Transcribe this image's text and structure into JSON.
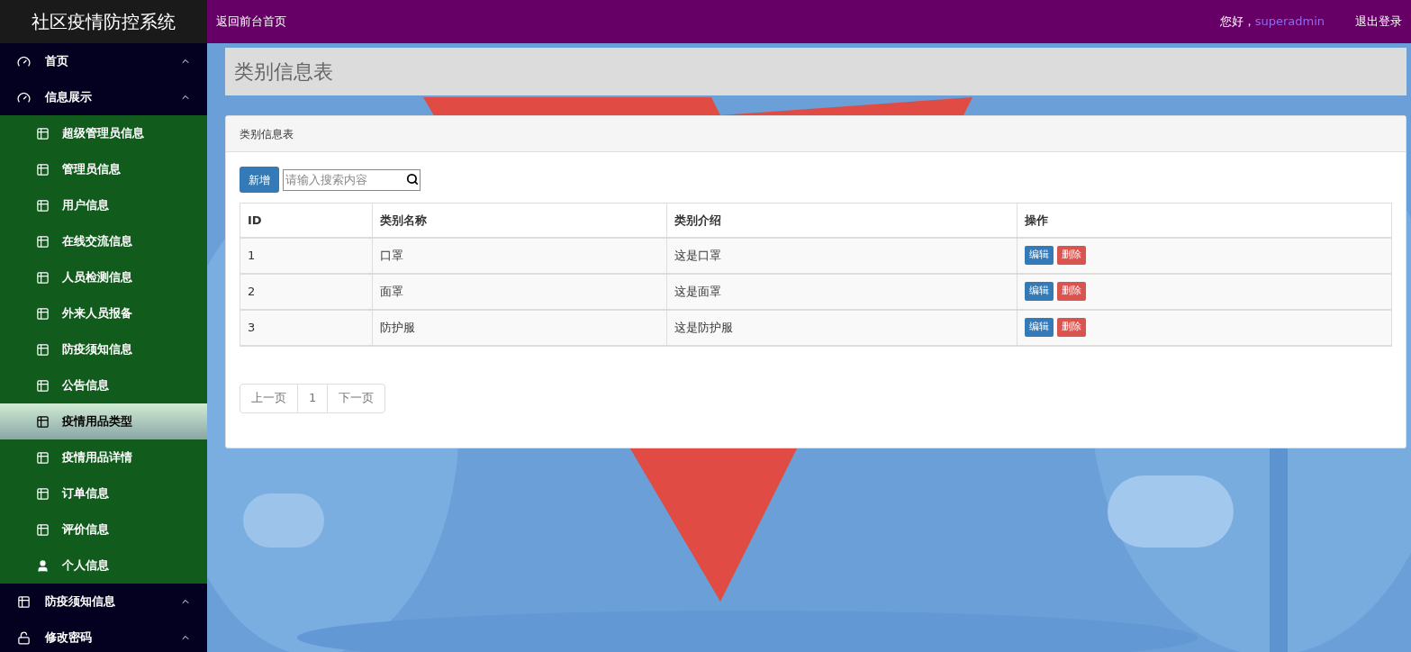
{
  "brand": "社区疫情防控系统",
  "topbar": {
    "home_link": "返回前台首页",
    "greeting": "您好，",
    "user": "superadmin",
    "logout": "退出登录"
  },
  "sidebar": {
    "groups": [
      {
        "label": "首页",
        "kind": "dashboard",
        "expanded": true
      },
      {
        "label": "信息展示",
        "kind": "dashboard",
        "expanded": true,
        "children": [
          {
            "label": "超级管理员信息",
            "kind": "table",
            "selected": false
          },
          {
            "label": "管理员信息",
            "kind": "table",
            "selected": false
          },
          {
            "label": "用户信息",
            "kind": "table",
            "selected": false
          },
          {
            "label": "在线交流信息",
            "kind": "table",
            "selected": false
          },
          {
            "label": "人员检测信息",
            "kind": "table",
            "selected": false
          },
          {
            "label": "外来人员报备",
            "kind": "table",
            "selected": false
          },
          {
            "label": "防疫须知信息",
            "kind": "table",
            "selected": false
          },
          {
            "label": "公告信息",
            "kind": "table",
            "selected": false
          },
          {
            "label": "疫情用品类型",
            "kind": "table",
            "selected": true
          },
          {
            "label": "疫情用品详情",
            "kind": "table",
            "selected": false
          },
          {
            "label": "订单信息",
            "kind": "table",
            "selected": false
          },
          {
            "label": "评价信息",
            "kind": "table",
            "selected": false
          },
          {
            "label": "个人信息",
            "kind": "user",
            "selected": false
          }
        ]
      },
      {
        "label": "防疫须知信息",
        "kind": "table",
        "expanded": true
      },
      {
        "label": "修改密码",
        "kind": "unlock",
        "expanded": true
      }
    ]
  },
  "page_title": "类别信息表",
  "panel": {
    "title": "类别信息表",
    "add_button": "新增",
    "search": {
      "placeholder": "请输入搜索内容"
    },
    "table": {
      "columns": [
        "ID",
        "类别名称",
        "类别介绍",
        "操作"
      ],
      "rows": [
        {
          "id": "1",
          "name": "口罩",
          "description": "这是口罩",
          "actions": [
            "编辑",
            "删除"
          ]
        },
        {
          "id": "2",
          "name": "面罩",
          "description": "这是面罩",
          "actions": [
            "编辑",
            "删除"
          ]
        },
        {
          "id": "3",
          "name": "防护服",
          "description": "这是防护服",
          "actions": [
            "编辑",
            "删除"
          ]
        }
      ]
    },
    "pagination": [
      "上一页",
      "1",
      "下一页"
    ]
  }
}
